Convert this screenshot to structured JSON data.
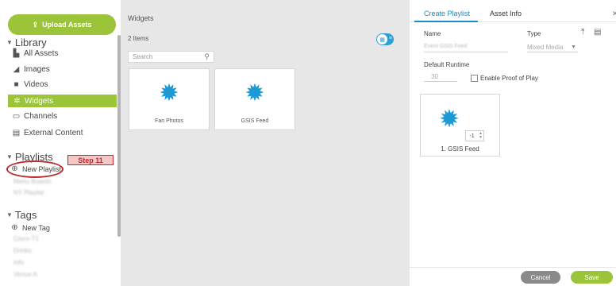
{
  "sidebar": {
    "upload_button": "Upload Assets",
    "library_heading": "Library",
    "library_items": [
      {
        "label": "All Assets",
        "icon": "folder-icon"
      },
      {
        "label": "Images",
        "icon": "image-icon"
      },
      {
        "label": "Videos",
        "icon": "video-icon"
      },
      {
        "label": "Widgets",
        "icon": "widget-gear-icon"
      },
      {
        "label": "Channels",
        "icon": "monitor-icon"
      },
      {
        "label": "External Content",
        "icon": "document-icon"
      }
    ],
    "playlists_heading": "Playlists",
    "new_playlist": "New Playlist",
    "blurred_playlists": [
      "Menu Boards",
      "NY Playlist"
    ],
    "tags_heading": "Tags",
    "new_tag": "New Tag",
    "blurred_tags": [
      "Cisco-T1",
      "Drinks",
      "Info",
      "Venue A"
    ]
  },
  "annotation": {
    "step_label": "Step 11",
    "highlight_color": "#b82a2f"
  },
  "widgets_panel": {
    "title": "Widgets",
    "item_count": "2 Items",
    "search_placeholder": "Search",
    "tiles": [
      {
        "label": "Fan Photos",
        "icon": "gear-icon"
      },
      {
        "label": "GSIS Feed",
        "icon": "gear-icon"
      }
    ]
  },
  "editor": {
    "tabs": [
      "Create Playlist",
      "Asset Info"
    ],
    "active_tab": "Create Playlist",
    "name_label": "Name",
    "name_value": "Event GSIS Feed",
    "type_label": "Type",
    "type_value": "Mixed Media",
    "runtime_label": "Default Runtime",
    "runtime_value": "30",
    "proof_of_play_label": "Enable Proof of Play",
    "proof_of_play_checked": false,
    "playlist_item": {
      "stepper_value": "-1",
      "caption": "1. GSIS Feed"
    },
    "cancel_label": "Cancel",
    "save_label": "Save"
  },
  "colors": {
    "accent_green": "#9bc43a",
    "accent_blue": "#1b8ccc",
    "gear_blue": "#1b9ad6"
  }
}
